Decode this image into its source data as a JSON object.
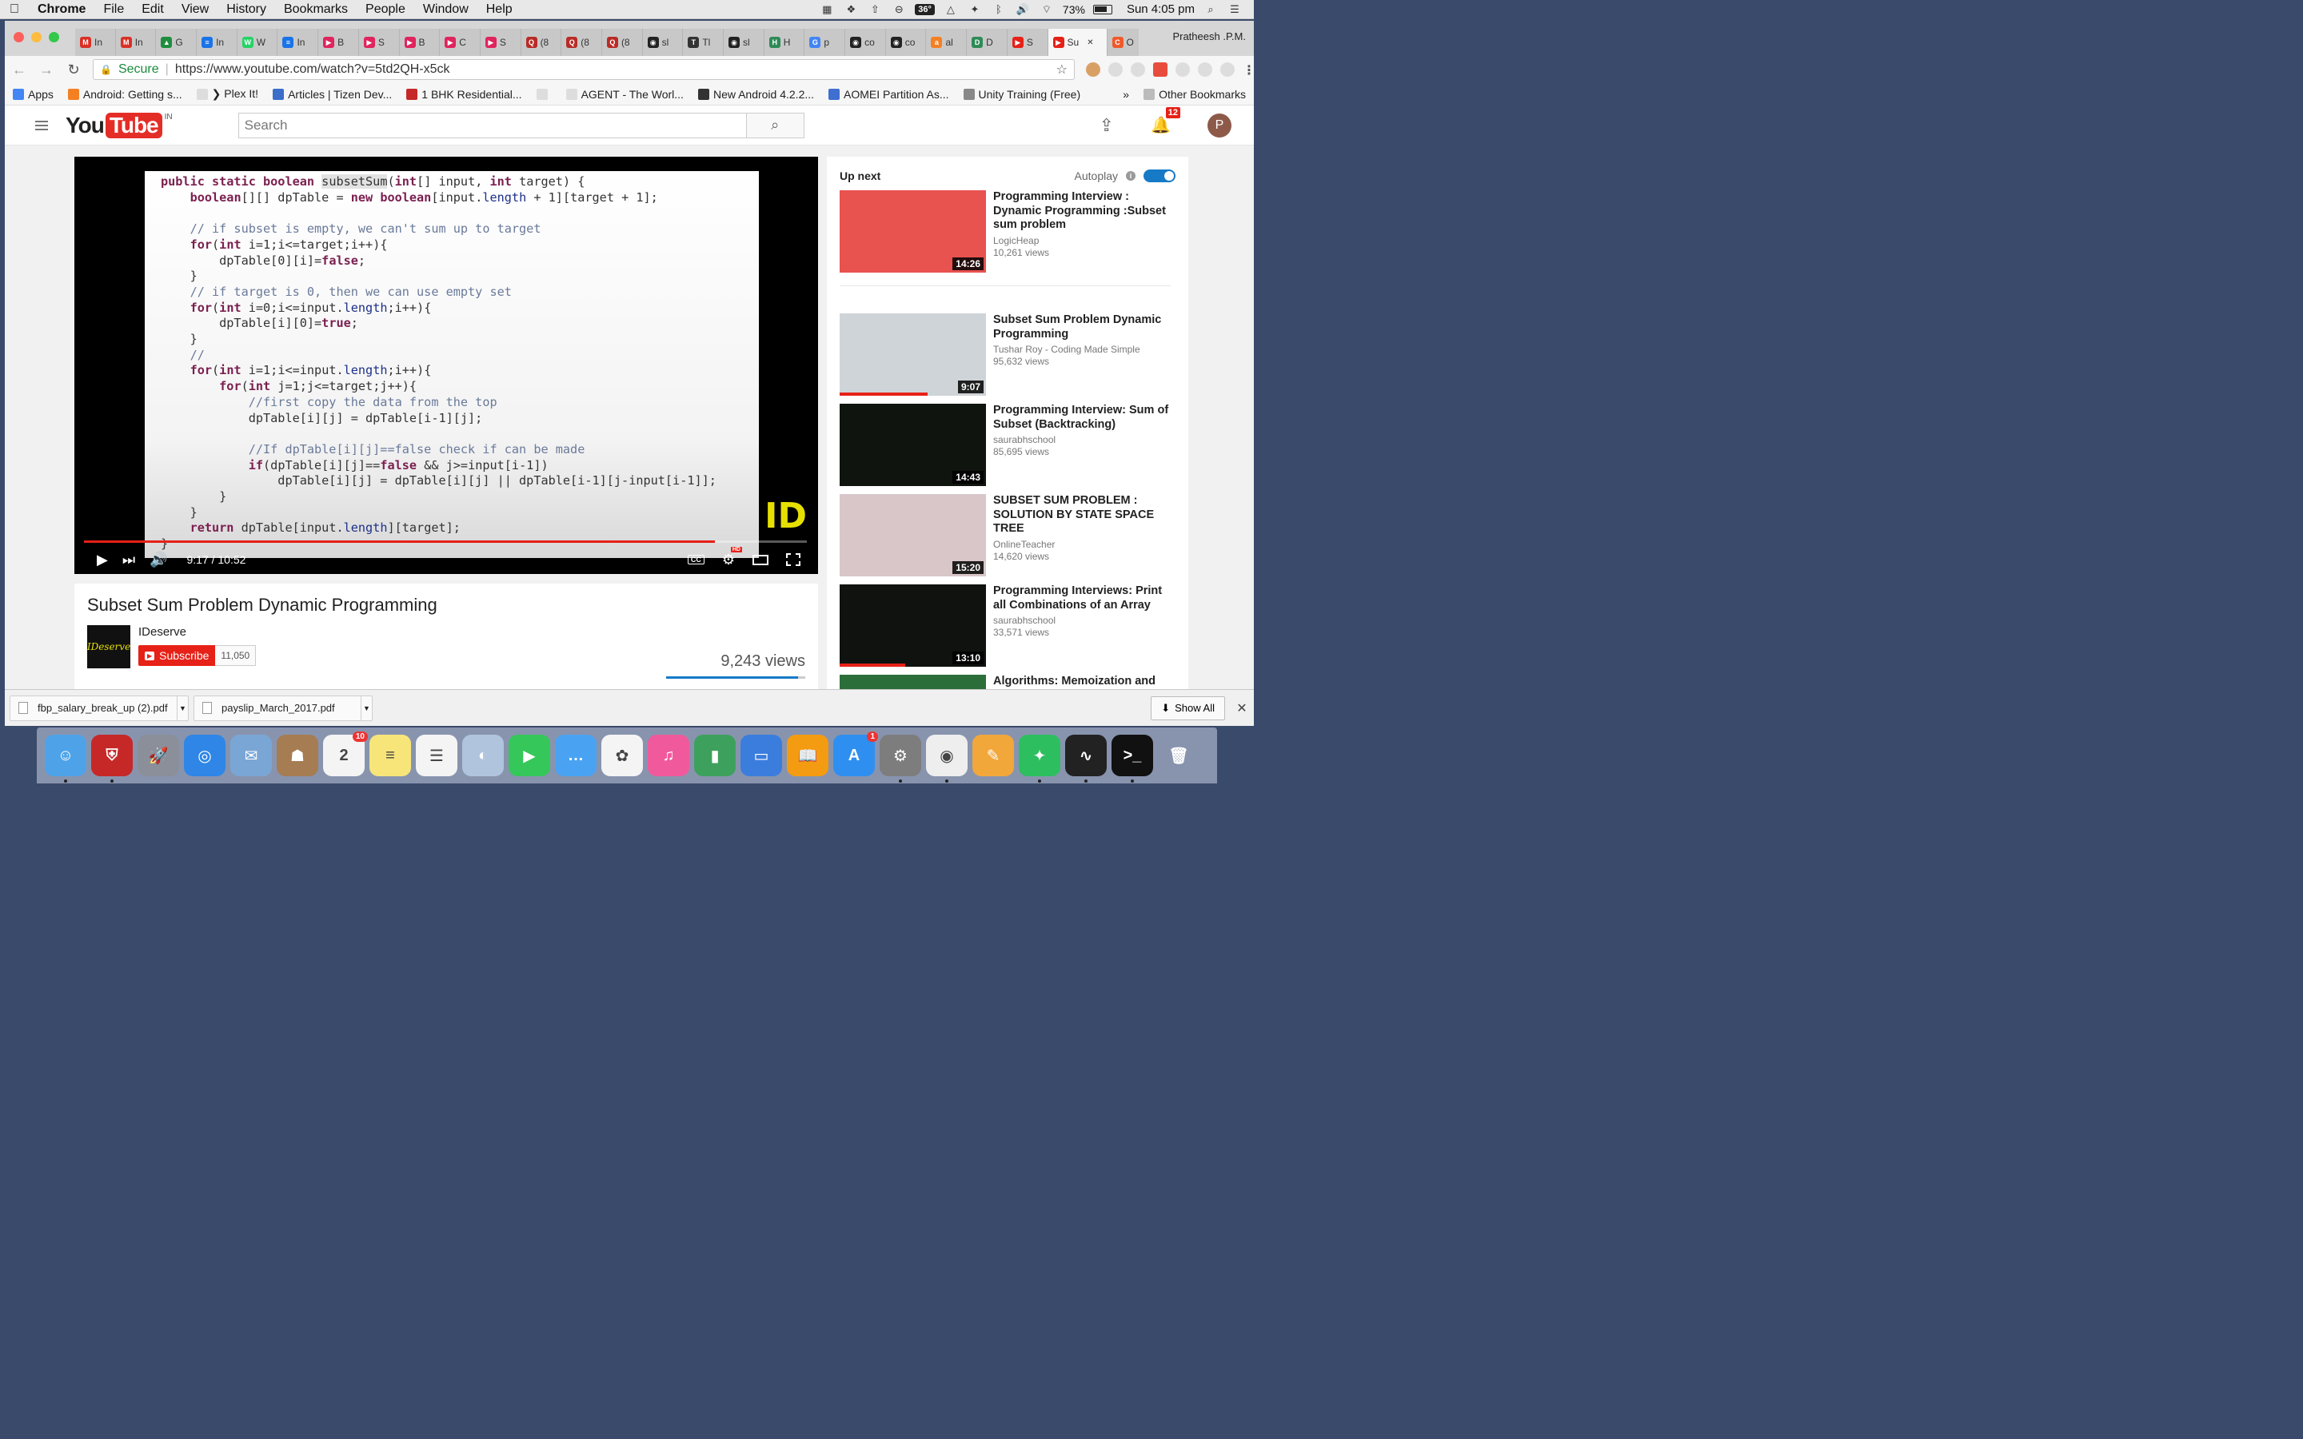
{
  "menubar": {
    "app": "Chrome",
    "items": [
      "File",
      "Edit",
      "View",
      "History",
      "Bookmarks",
      "People",
      "Window",
      "Help"
    ],
    "temperature": "36°",
    "battery": "73%",
    "clock": "Sun 4:05 pm"
  },
  "tabs": [
    {
      "icon": "M",
      "color": "#d93025",
      "label": "In"
    },
    {
      "icon": "M",
      "color": "#d93025",
      "label": "In"
    },
    {
      "icon": "▲",
      "color": "#1e8e3e",
      "label": "G"
    },
    {
      "icon": "≡",
      "color": "#1a73e8",
      "label": "In"
    },
    {
      "icon": "W",
      "color": "#25d366",
      "label": "W"
    },
    {
      "icon": "≡",
      "color": "#1a73e8",
      "label": "In"
    },
    {
      "icon": "▶",
      "color": "#e0245e",
      "label": "B"
    },
    {
      "icon": "▶",
      "color": "#e0245e",
      "label": "S"
    },
    {
      "icon": "▶",
      "color": "#e0245e",
      "label": "B"
    },
    {
      "icon": "▶",
      "color": "#e0245e",
      "label": "C"
    },
    {
      "icon": "▶",
      "color": "#e0245e",
      "label": "S"
    },
    {
      "icon": "Q",
      "color": "#b92b27",
      "label": "(8"
    },
    {
      "icon": "Q",
      "color": "#b92b27",
      "label": "(8"
    },
    {
      "icon": "Q",
      "color": "#b92b27",
      "label": "(8"
    },
    {
      "icon": "◉",
      "color": "#222222",
      "label": "sl"
    },
    {
      "icon": "T",
      "color": "#333333",
      "label": "Tl"
    },
    {
      "icon": "◉",
      "color": "#222222",
      "label": "sl"
    },
    {
      "icon": "H",
      "color": "#2e8b57",
      "label": "H"
    },
    {
      "icon": "G",
      "color": "#4285f4",
      "label": "p"
    },
    {
      "icon": "◉",
      "color": "#222222",
      "label": "co"
    },
    {
      "icon": "◉",
      "color": "#222222",
      "label": "co"
    },
    {
      "icon": "a",
      "color": "#f48024",
      "label": "al"
    },
    {
      "icon": "D",
      "color": "#2e8b57",
      "label": "D"
    },
    {
      "icon": "▶",
      "color": "#e62117",
      "label": "S"
    },
    {
      "icon": "▶",
      "color": "#e62117",
      "label": "Su",
      "active": true
    },
    {
      "icon": "C",
      "color": "#f0592a",
      "label": "O"
    }
  ],
  "profile": "Pratheesh .P.M.",
  "omnibar": {
    "secure_label": "Secure",
    "url": "https://www.youtube.com/watch?v=5td2QH-x5ck"
  },
  "bookmarks": {
    "items": [
      {
        "label": "Apps",
        "color": "#4285f4"
      },
      {
        "label": "Android: Getting s...",
        "color": "#f48024"
      },
      {
        "label": "❯ Plex It!",
        "color": "#dddddd"
      },
      {
        "label": "Articles | Tizen Dev...",
        "color": "#3a6ec9"
      },
      {
        "label": "1 BHK Residential...",
        "color": "#c62828"
      },
      {
        "label": "",
        "color": "#dddddd"
      },
      {
        "label": "AGENT - The Worl...",
        "color": "#dddddd"
      },
      {
        "label": "New Android 4.2.2...",
        "color": "#333333"
      },
      {
        "label": "AOMEI Partition As...",
        "color": "#3f6fd1"
      },
      {
        "label": "Unity Training (Free)",
        "color": "#888888"
      }
    ],
    "overflow": "»",
    "other": "Other Bookmarks"
  },
  "youtube": {
    "logo_you": "You",
    "logo_tube": "Tube",
    "region": "IN",
    "search_placeholder": "Search",
    "notifications": "12",
    "avatar_letter": "P"
  },
  "player": {
    "code_lines": [
      [
        [
          "kw",
          "public static boolean "
        ],
        [
          "hl",
          "subsetSum"
        ],
        [
          "t",
          "("
        ],
        [
          "kw",
          "int"
        ],
        [
          "t",
          "[] input, "
        ],
        [
          "kw",
          "int"
        ],
        [
          "t",
          " target) {"
        ]
      ],
      [
        [
          "t",
          "    "
        ],
        [
          "kw",
          "boolean"
        ],
        [
          "t",
          "[][] dpTable = "
        ],
        [
          "kw",
          "new boolean"
        ],
        [
          "t",
          "[input."
        ],
        [
          "fld",
          "length"
        ],
        [
          "t",
          " + 1][target + 1];"
        ]
      ],
      [
        [
          "t",
          ""
        ]
      ],
      [
        [
          "cm",
          "    // if subset is empty, we can't sum up to target"
        ]
      ],
      [
        [
          "t",
          "    "
        ],
        [
          "kw",
          "for"
        ],
        [
          "t",
          "("
        ],
        [
          "kw",
          "int"
        ],
        [
          "t",
          " i=1;i<=target;i++){"
        ]
      ],
      [
        [
          "t",
          "        dpTable[0][i]="
        ],
        [
          "kw",
          "false"
        ],
        [
          "t",
          ";"
        ]
      ],
      [
        [
          "t",
          "    }"
        ]
      ],
      [
        [
          "cm",
          "    // if target is 0, then we can use empty set"
        ]
      ],
      [
        [
          "t",
          "    "
        ],
        [
          "kw",
          "for"
        ],
        [
          "t",
          "("
        ],
        [
          "kw",
          "int"
        ],
        [
          "t",
          " i=0;i<=input."
        ],
        [
          "fld",
          "length"
        ],
        [
          "t",
          ";i++){"
        ]
      ],
      [
        [
          "t",
          "        dpTable[i][0]="
        ],
        [
          "kw",
          "true"
        ],
        [
          "t",
          ";"
        ]
      ],
      [
        [
          "t",
          "    }"
        ]
      ],
      [
        [
          "cm",
          "    //"
        ]
      ],
      [
        [
          "t",
          "    "
        ],
        [
          "kw",
          "for"
        ],
        [
          "t",
          "("
        ],
        [
          "kw",
          "int"
        ],
        [
          "t",
          " i=1;i<=input."
        ],
        [
          "fld",
          "length"
        ],
        [
          "t",
          ";i++){"
        ]
      ],
      [
        [
          "t",
          "        "
        ],
        [
          "kw",
          "for"
        ],
        [
          "t",
          "("
        ],
        [
          "kw",
          "int"
        ],
        [
          "t",
          " j=1;j<=target;j++){"
        ]
      ],
      [
        [
          "cm",
          "            //first copy the data from the top"
        ]
      ],
      [
        [
          "t",
          "            dpTable[i][j] = dpTable[i-1][j];"
        ]
      ],
      [
        [
          "t",
          ""
        ]
      ],
      [
        [
          "cm",
          "            //If dpTable[i][j]==false check if can be made"
        ]
      ],
      [
        [
          "t",
          "            "
        ],
        [
          "kw",
          "if"
        ],
        [
          "t",
          "(dpTable[i][j]=="
        ],
        [
          "kw",
          "false"
        ],
        [
          "t",
          " && j>=input[i-1])"
        ]
      ],
      [
        [
          "t",
          "                dpTable[i][j] = dpTable[i][j] || dpTable[i-1][j-input[i-1]];"
        ]
      ],
      [
        [
          "t",
          "        }"
        ]
      ],
      [
        [
          "t",
          "    }"
        ]
      ],
      [
        [
          "t",
          "    "
        ],
        [
          "kw",
          "return"
        ],
        [
          "t",
          " dpTable[input."
        ],
        [
          "fld",
          "length"
        ],
        [
          "t",
          "][target];"
        ]
      ],
      [
        [
          "t",
          "}"
        ]
      ]
    ],
    "brand_mark": "ID",
    "time": "9:17 / 10:52",
    "progress": 0.8729,
    "cc_label": "CC",
    "hd_label": "HD"
  },
  "video": {
    "title": "Subset Sum Problem Dynamic Programming",
    "channel": "IDeserve",
    "channel_logo_text": "IDeserve",
    "subscribe_label": "Subscribe",
    "subscriber_count": "11,050",
    "views": "9,243 views",
    "like_ratio": 0.95
  },
  "upnext": {
    "title": "Up next",
    "autoplay_label": "Autoplay",
    "videos": [
      {
        "title": "Programming Interview : Dynamic Programming :Subset sum problem",
        "channel": "LogicHeap",
        "views": "10,261 views",
        "duration": "14:26",
        "thumb": "#e8524f",
        "watched": 0
      },
      {
        "title": "Subset Sum Problem Dynamic Programming",
        "channel": "Tushar Roy - Coding Made Simple",
        "views": "95,632 views",
        "duration": "9:07",
        "thumb": "#cfd4d8",
        "watched": 0.6
      },
      {
        "title": "Programming Interview: Sum of Subset (Backtracking)",
        "channel": "saurabhschool",
        "views": "85,695 views",
        "duration": "14:43",
        "thumb": "#0f140f",
        "watched": 0
      },
      {
        "title": "SUBSET SUM PROBLEM : SOLUTION BY STATE SPACE TREE",
        "channel": "OnlineTeacher",
        "views": "14,620 views",
        "duration": "15:20",
        "thumb": "#d9c6c9",
        "watched": 0
      },
      {
        "title": "Programming Interviews: Print all Combinations of an Array",
        "channel": "saurabhschool",
        "views": "33,571 views",
        "duration": "13:10",
        "thumb": "#0f120f",
        "watched": 0.45
      },
      {
        "title": "Algorithms: Memoization and",
        "channel": "",
        "views": "",
        "duration": "",
        "thumb": "#2c6e3a",
        "watched": 0
      }
    ]
  },
  "downloads": {
    "items": [
      "fbp_salary_break_up (2).pdf",
      "payslip_March_2017.pdf"
    ],
    "show_all": "Show All"
  },
  "dock": {
    "apps": [
      {
        "name": "finder-icon",
        "color": "#4ea3e8",
        "glyph": "☺",
        "running": true
      },
      {
        "name": "antivirus-icon",
        "color": "#c62828",
        "glyph": "⛨",
        "running": true
      },
      {
        "name": "launchpad-icon",
        "color": "#8a8f99",
        "glyph": "🚀",
        "running": false
      },
      {
        "name": "safari-icon",
        "color": "#2f86e6",
        "glyph": "◎",
        "running": false
      },
      {
        "name": "mail-icon",
        "color": "#7aa6d6",
        "glyph": "✉",
        "running": false
      },
      {
        "name": "contacts-icon",
        "color": "#a67c52",
        "glyph": "☗",
        "running": false
      },
      {
        "name": "calendar-icon",
        "color": "#f4f4f4",
        "glyph": "2",
        "running": false,
        "badge": "10"
      },
      {
        "name": "notes-icon",
        "color": "#f7e57a",
        "glyph": "≡",
        "running": false
      },
      {
        "name": "reminders-icon",
        "color": "#f4f4f4",
        "glyph": "☰",
        "running": false
      },
      {
        "name": "photo-booth-icon",
        "color": "#b0c4de",
        "glyph": "◐",
        "running": false
      },
      {
        "name": "facetime-icon",
        "color": "#35c759",
        "glyph": "▶",
        "running": false
      },
      {
        "name": "messages-icon",
        "color": "#4aa3f2",
        "glyph": "…",
        "running": false
      },
      {
        "name": "photos-icon",
        "color": "#f4f4f4",
        "glyph": "✿",
        "running": false
      },
      {
        "name": "itunes-icon",
        "color": "#f05a9c",
        "glyph": "♫",
        "running": false
      },
      {
        "name": "numbers-icon",
        "color": "#3da15d",
        "glyph": "▮",
        "running": false
      },
      {
        "name": "keynote-icon",
        "color": "#3b7ddd",
        "glyph": "▭",
        "running": false
      },
      {
        "name": "ibooks-icon",
        "color": "#f39c12",
        "glyph": "📖",
        "running": false
      },
      {
        "name": "app-store-icon",
        "color": "#2e8ff0",
        "glyph": "A",
        "running": false,
        "badge": "1"
      },
      {
        "name": "system-preferences-icon",
        "color": "#7d7d7d",
        "glyph": "⚙",
        "running": true
      },
      {
        "name": "chrome-icon",
        "color": "#eeeeee",
        "glyph": "◉",
        "running": true
      },
      {
        "name": "pages-icon",
        "color": "#f2a73b",
        "glyph": "✎",
        "running": false
      },
      {
        "name": "evernote-icon",
        "color": "#2dbe60",
        "glyph": "✦",
        "running": true
      },
      {
        "name": "activity-monitor-icon",
        "color": "#222222",
        "glyph": "∿",
        "running": true
      },
      {
        "name": "terminal-icon",
        "color": "#111111",
        "glyph": ">_",
        "running": true
      },
      {
        "name": "trash-icon",
        "color": "transparent",
        "glyph": "🗑",
        "running": false
      }
    ]
  }
}
